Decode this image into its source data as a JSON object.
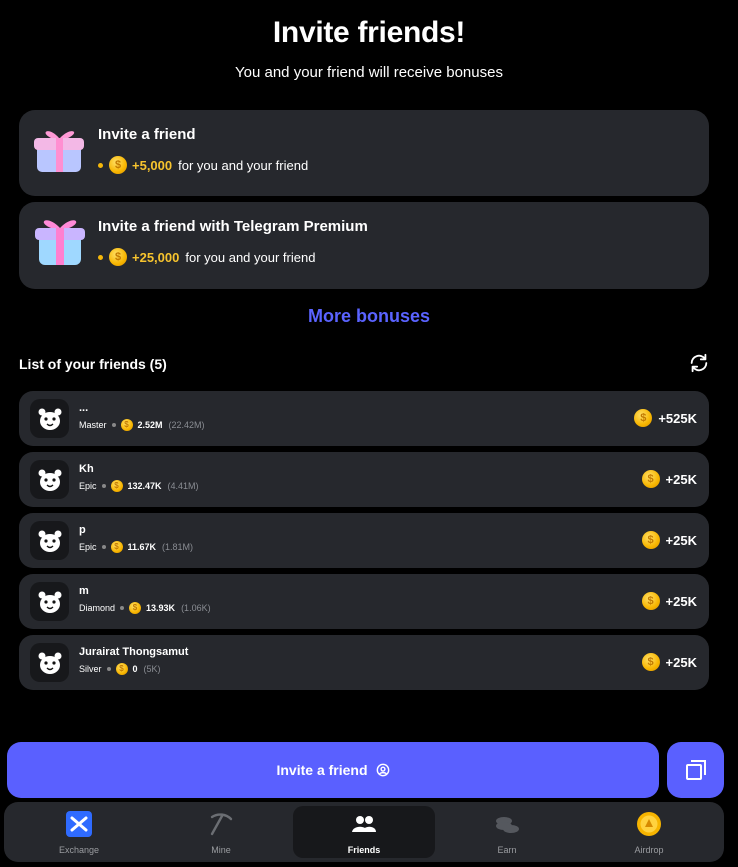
{
  "header": {
    "title": "Invite friends!",
    "subtitle": "You and your friend will receive bonuses"
  },
  "offers": [
    {
      "title": "Invite a friend",
      "amount": "+5,000",
      "desc": "for you and your friend"
    },
    {
      "title": "Invite a friend with Telegram Premium",
      "amount": "+25,000",
      "desc": "for you and your friend"
    }
  ],
  "more_bonuses": "More bonuses",
  "friends_header": "List of your friends (5)",
  "friends": [
    {
      "name": "...",
      "league": "Master",
      "coins": "2.52M",
      "total": "(22.42M)",
      "reward": "+525K"
    },
    {
      "name": "Kh",
      "league": "Epic",
      "coins": "132.47K",
      "total": "(4.41M)",
      "reward": "+25K"
    },
    {
      "name": "p",
      "league": "Epic",
      "coins": "11.67K",
      "total": "(1.81M)",
      "reward": "+25K"
    },
    {
      "name": "m",
      "league": "Diamond",
      "coins": "13.93K",
      "total": "(1.06K)",
      "reward": "+25K"
    },
    {
      "name": "Jurairat Thongsamut",
      "league": "Silver",
      "coins": "0",
      "total": "(5K)",
      "reward": "+25K"
    }
  ],
  "invite_button": "Invite a friend",
  "nav": [
    {
      "label": "Exchange",
      "icon": "exchange-icon"
    },
    {
      "label": "Mine",
      "icon": "pickaxe-icon"
    },
    {
      "label": "Friends",
      "icon": "friends-icon"
    },
    {
      "label": "Earn",
      "icon": "coins-stack-icon"
    },
    {
      "label": "Airdrop",
      "icon": "airdrop-coin-icon"
    }
  ],
  "colors": {
    "accent": "#5a60ff",
    "gold": "#f7c42e",
    "card": "#26282d"
  }
}
